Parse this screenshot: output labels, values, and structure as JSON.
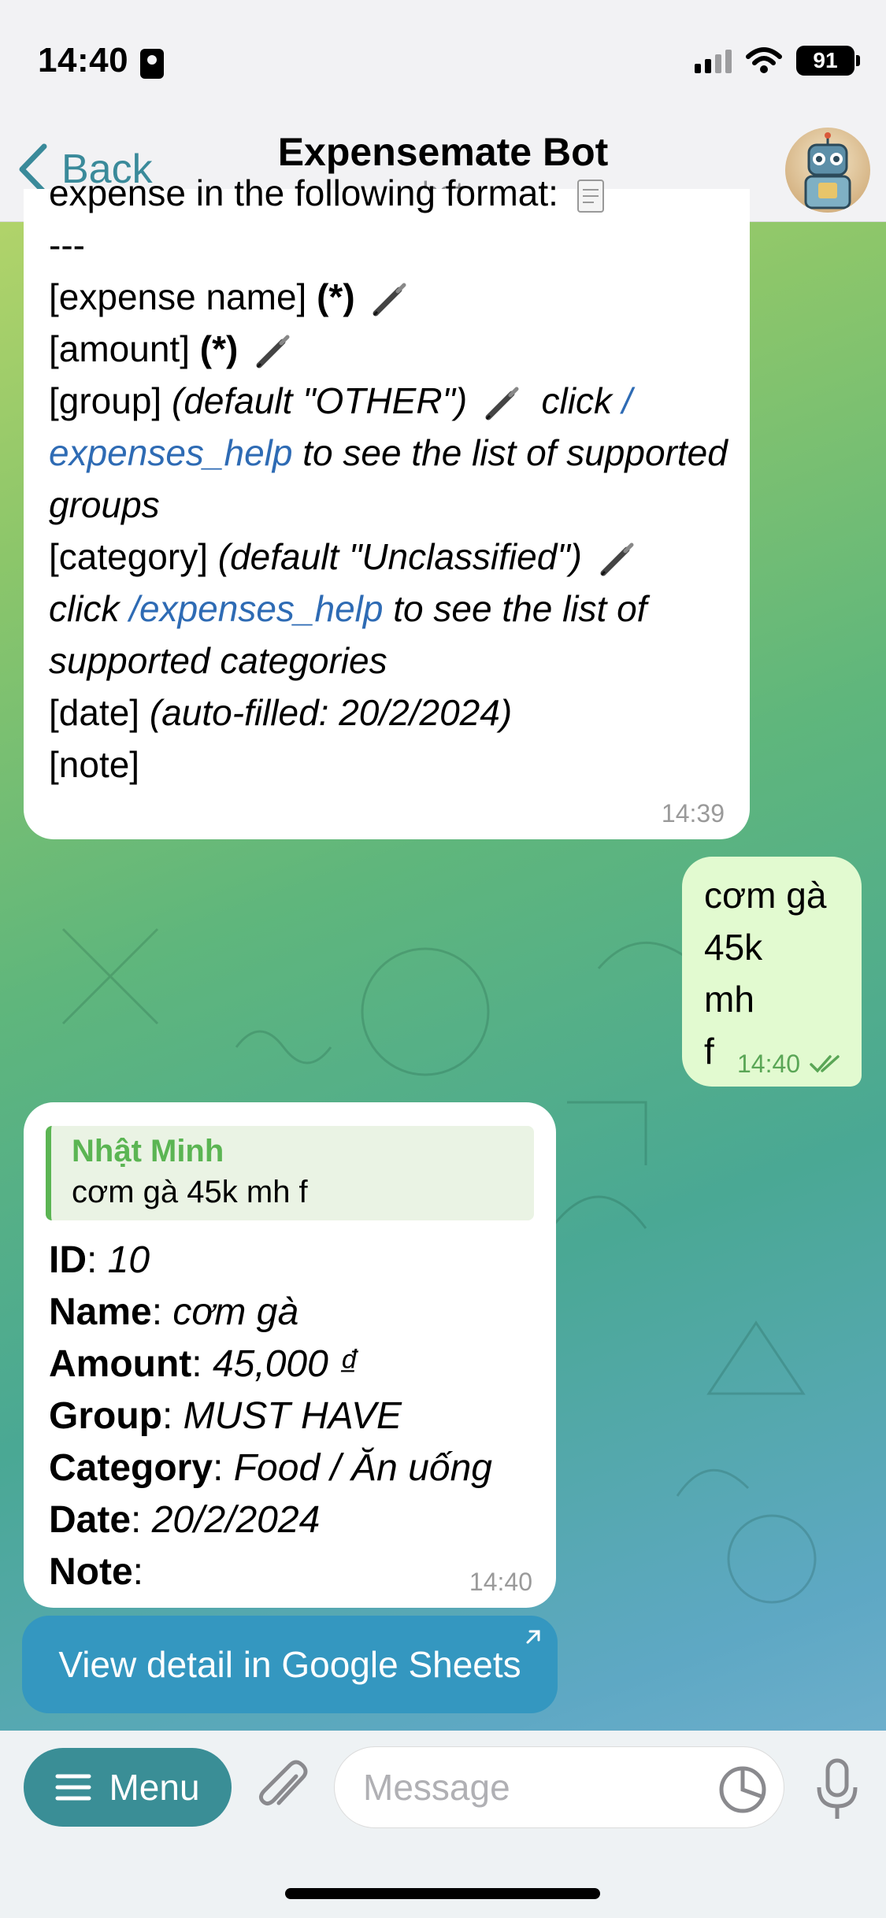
{
  "status_bar": {
    "time": "14:40",
    "battery": "91"
  },
  "header": {
    "back_label": "Back",
    "title": "Expensemate Bot",
    "subtitle": "bot"
  },
  "messages": {
    "bot_help": {
      "line0": "expense in the following format:",
      "line1": "---",
      "expense_name": "[expense name]",
      "required": "(*)",
      "amount": "[amount]",
      "group": "[group]",
      "group_default": "(default \"OTHER\")",
      "click": "click",
      "cmd": "/expenses_help",
      "cmd_part1": "/",
      "cmd_part2": "expenses_help",
      "see_groups": "to see the list of supported groups",
      "category": "[category]",
      "category_default": "(default \"Unclassified\")",
      "see_categories": "to see the list of supported categories",
      "date": "[date]",
      "date_auto": "(auto-filled: 20/2/2024)",
      "note": "[note]",
      "time": "14:39"
    },
    "user_msg": {
      "lines": [
        "cơm gà",
        "45k",
        "mh",
        "f"
      ],
      "time": "14:40"
    },
    "bot_reply": {
      "quote_name": "Nhật Minh",
      "quote_text": "cơm gà 45k mh f",
      "id_label": "ID",
      "id_value": "10",
      "name_label": "Name",
      "name_value": "cơm gà",
      "amount_label": "Amount",
      "amount_value": "45,000 ₫",
      "group_label": "Group",
      "group_value": "MUST HAVE",
      "category_label": "Category",
      "category_value": "Food / Ăn uống",
      "date_label": "Date",
      "date_value": "20/2/2024",
      "note_label": "Note",
      "note_value": "",
      "time": "14:40"
    },
    "sheets_button": "View detail in Google Sheets"
  },
  "input_bar": {
    "menu_label": "Menu",
    "placeholder": "Message"
  },
  "colors": {
    "accent": "#3a8e96",
    "link": "#2e6bb4",
    "outgoing_bubble": "#e2fad0",
    "quote_name": "#5bb553"
  }
}
